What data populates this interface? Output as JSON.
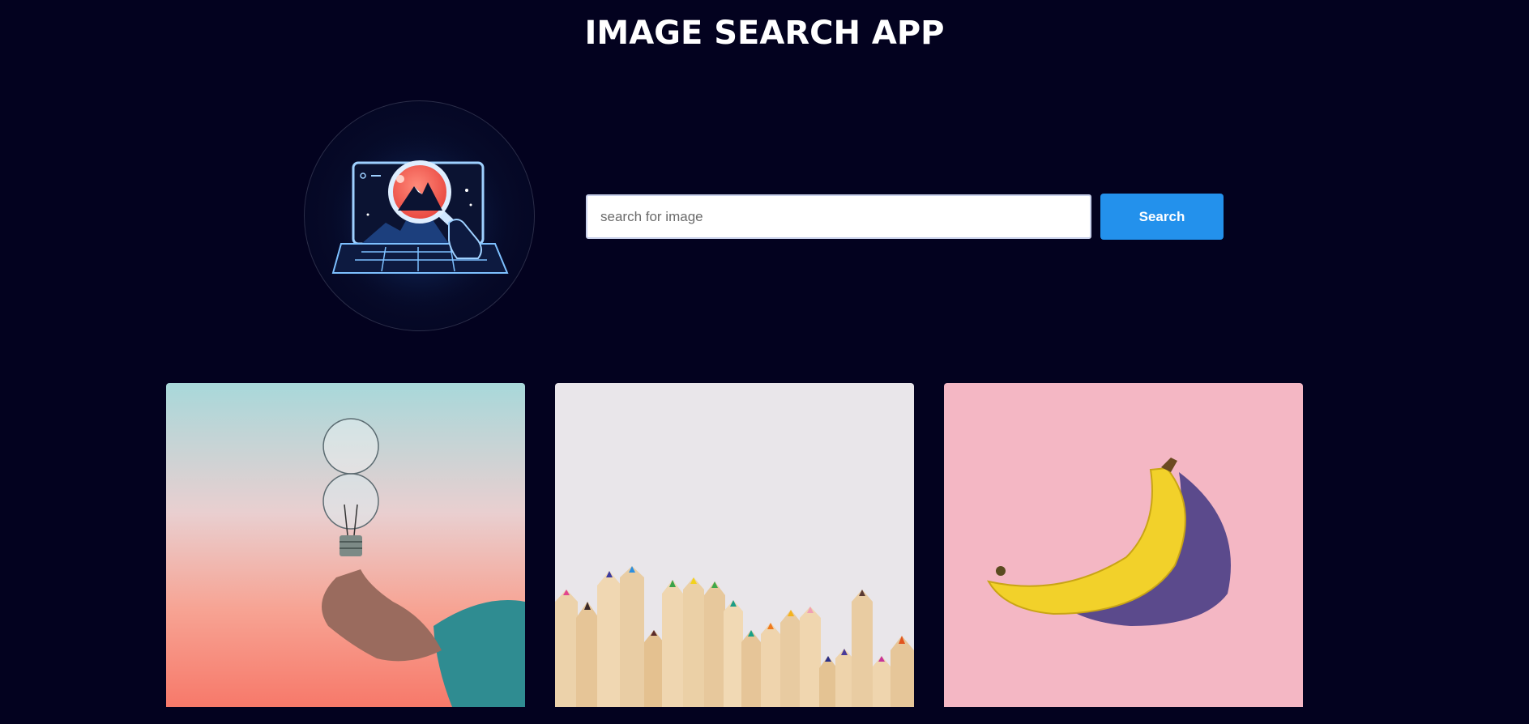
{
  "header": {
    "title": "IMAGE SEARCH APP"
  },
  "logo": {
    "icon": "image-search-laptop-icon"
  },
  "search": {
    "placeholder": "search for image",
    "value": "",
    "button_label": "Search"
  },
  "results": [
    {
      "subject": "lightbulb-in-hand",
      "bg_top": "#a8d8da",
      "bg_bottom": "#f7796a"
    },
    {
      "subject": "colored-pencils",
      "bg_top": "#e9e6ea",
      "bg_bottom": "#e3d6c4"
    },
    {
      "subject": "banana",
      "bg_top": "#f4b7c4",
      "bg_bottom": "#f4b7c4"
    }
  ],
  "colors": {
    "background": "#03021f",
    "accent": "#2391ec",
    "title": "#ffffff"
  }
}
